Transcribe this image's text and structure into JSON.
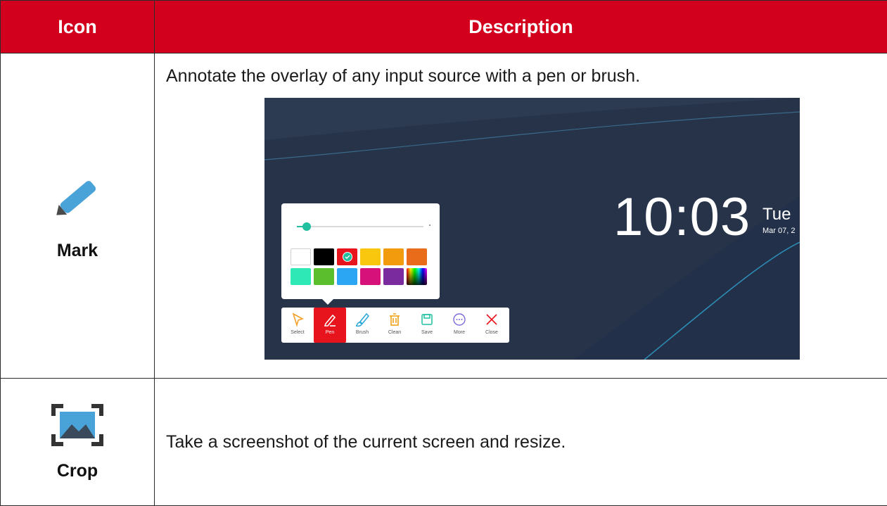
{
  "header": {
    "icon_col": "Icon",
    "desc_col": "Description"
  },
  "rows": [
    {
      "label": "Mark",
      "icon": "pen-icon",
      "description": "Annotate the overlay of any input source with a pen or brush.",
      "screenshot": {
        "time": "10:03",
        "day": "Tue",
        "date": "Mar 07, 2",
        "brush_size_fraction": 0.08,
        "swatches": [
          "#ffffff",
          "#000000",
          "#e8141d",
          "#f9c80e",
          "#f29b0c",
          "#e86c1a",
          "#2ee8b6",
          "#5bbf2d",
          "#2aa6f2",
          "#d6117a",
          "#7a2c9e",
          "rainbow"
        ],
        "selected_swatch": "#e8141d",
        "tools": [
          {
            "label": "Select",
            "icon": "select-arrow-icon"
          },
          {
            "label": "Pen",
            "icon": "pen-icon",
            "active": true
          },
          {
            "label": "Brush",
            "icon": "brush-icon"
          },
          {
            "label": "Clean",
            "icon": "trash-icon"
          },
          {
            "label": "Save",
            "icon": "save-icon"
          },
          {
            "label": "More",
            "icon": "more-icon"
          },
          {
            "label": "Close",
            "icon": "close-icon"
          }
        ]
      }
    },
    {
      "label": "Crop",
      "icon": "crop-image-icon",
      "description": "Take a screenshot of the current screen and resize."
    }
  ]
}
